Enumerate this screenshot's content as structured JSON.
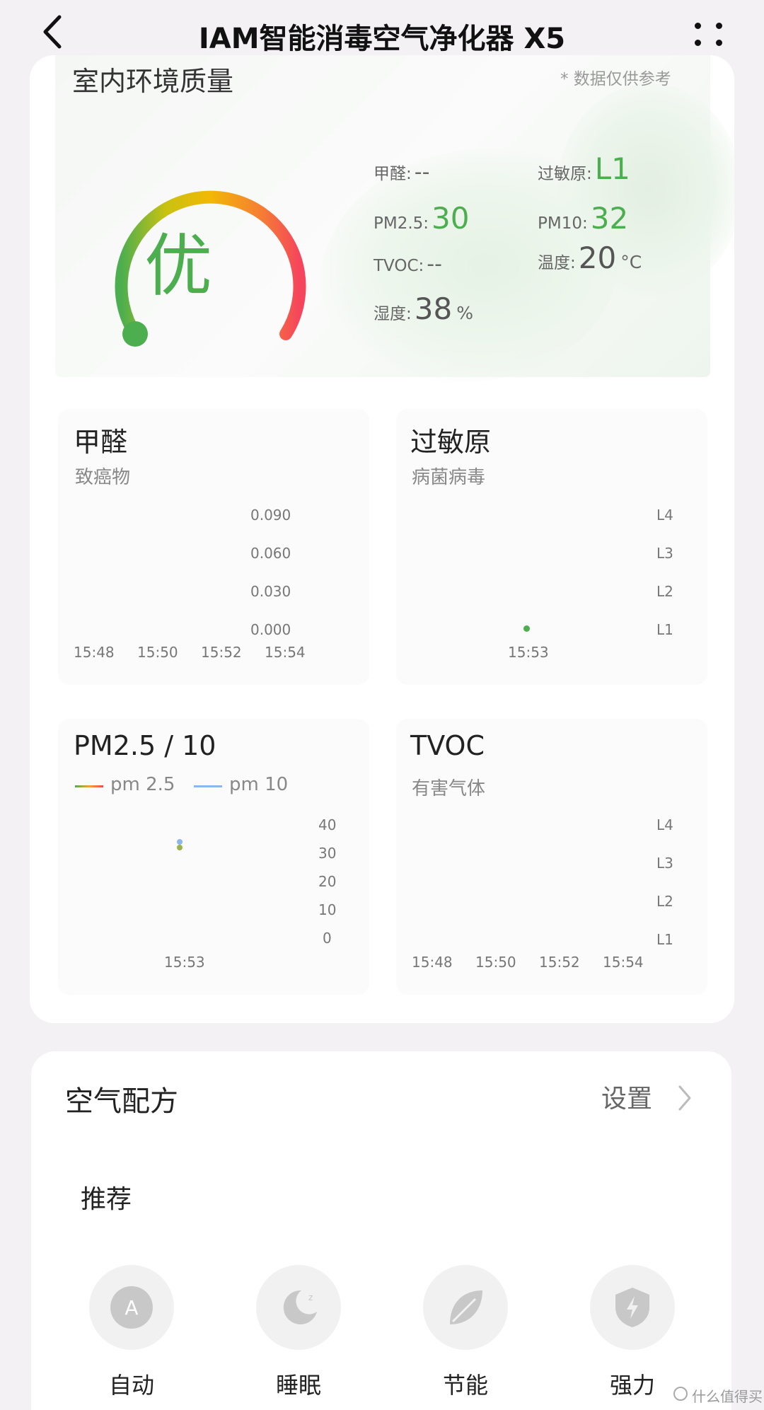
{
  "header": {
    "title": "IAM智能消毒空气净化器 X5"
  },
  "environment": {
    "title": "室内环境质量",
    "disclaimer": "* 数据仅供参考",
    "quality": "优",
    "metrics": {
      "formaldehyde": {
        "label": "甲醛:",
        "value": "--"
      },
      "allergen": {
        "label": "过敏原:",
        "value": "L1"
      },
      "pm25": {
        "label": "PM2.5:",
        "value": "30"
      },
      "pm10": {
        "label": "PM10:",
        "value": "32"
      },
      "tvoc": {
        "label": "TVOC:",
        "value": "--"
      },
      "temperature": {
        "label": "温度:",
        "value": "20",
        "unit": "°C"
      },
      "humidity": {
        "label": "湿度:",
        "value": "38",
        "unit": "%"
      }
    },
    "charts": {
      "formaldehyde": {
        "title": "甲醛",
        "subtitle": "致癌物",
        "y_ticks": [
          "0.090",
          "0.060",
          "0.030",
          "0.000"
        ],
        "x_ticks": [
          "15:48",
          "15:50",
          "15:52",
          "15:54"
        ]
      },
      "allergen": {
        "title": "过敏原",
        "subtitle": "病菌病毒",
        "y_ticks": [
          "L4",
          "L3",
          "L2",
          "L1"
        ],
        "x_ticks": [
          "15:53"
        ]
      },
      "pm": {
        "title": "PM2.5 / 10",
        "legend": [
          "pm 2.5",
          "pm 10"
        ],
        "y_ticks": [
          "40",
          "30",
          "20",
          "10",
          "0"
        ],
        "x_ticks": [
          "15:53"
        ]
      },
      "tvoc": {
        "title": "TVOC",
        "subtitle": "有害气体",
        "y_ticks": [
          "L4",
          "L3",
          "L2",
          "L1"
        ],
        "x_ticks": [
          "15:48",
          "15:50",
          "15:52",
          "15:54"
        ]
      }
    }
  },
  "chart_data": [
    {
      "type": "line",
      "title": "甲醛",
      "subtitle": "致癌物",
      "categories": [
        "15:48",
        "15:50",
        "15:52",
        "15:54"
      ],
      "series": [
        {
          "values": []
        }
      ],
      "ylim": [
        0,
        0.09
      ]
    },
    {
      "type": "scatter",
      "title": "过敏原",
      "subtitle": "病菌病毒",
      "y_categories": [
        "L1",
        "L2",
        "L3",
        "L4"
      ],
      "series": [
        {
          "x": [
            "15:53"
          ],
          "y": [
            "L1"
          ]
        }
      ]
    },
    {
      "type": "line",
      "title": "PM2.5 / 10",
      "x": [
        "15:53"
      ],
      "series": [
        {
          "name": "pm 2.5",
          "values": [
            30
          ]
        },
        {
          "name": "pm 10",
          "values": [
            32
          ]
        }
      ],
      "ylim": [
        0,
        40
      ]
    },
    {
      "type": "line",
      "title": "TVOC",
      "subtitle": "有害气体",
      "categories": [
        "15:48",
        "15:50",
        "15:52",
        "15:54"
      ],
      "y_categories": [
        "L1",
        "L2",
        "L3",
        "L4"
      ],
      "series": [
        {
          "values": []
        }
      ]
    }
  ],
  "formula": {
    "title": "空气配方",
    "settings_label": "设置",
    "recommend_label": "推荐",
    "modes": [
      {
        "label": "自动",
        "icon": "auto-icon",
        "glyph": "A"
      },
      {
        "label": "睡眠",
        "icon": "moon-icon"
      },
      {
        "label": "节能",
        "icon": "leaf-icon"
      },
      {
        "label": "强力",
        "icon": "shield-bolt-icon"
      }
    ]
  },
  "watermark": "什么值得买",
  "colors": {
    "accent_green": "#4cae4f",
    "gauge_start": "#4cae4f",
    "gauge_mid": "#f2b806",
    "gauge_end": "#f5455c",
    "pm25_color": "#f3a431",
    "pm10_color": "#8bb8e8"
  }
}
